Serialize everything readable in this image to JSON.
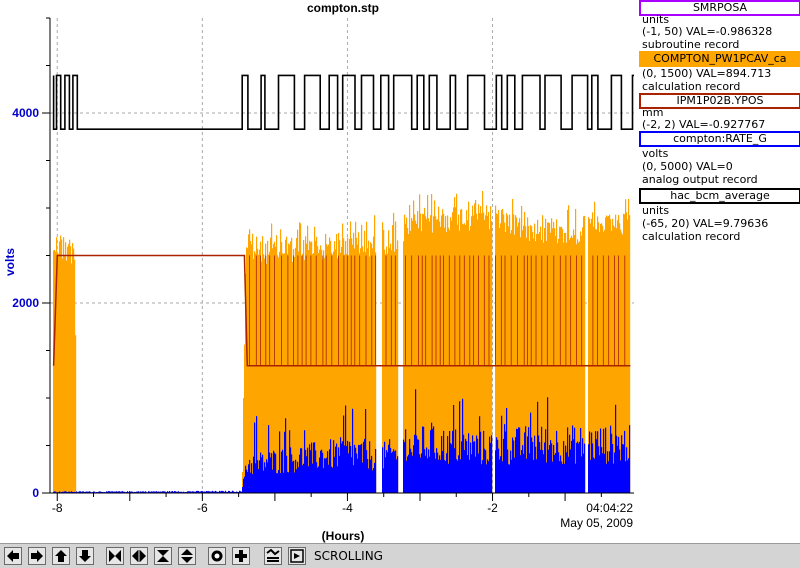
{
  "window": {
    "title": "compton.stp"
  },
  "chart_data": {
    "type": "line",
    "title": "compton.stp",
    "xlabel": "(Hours)",
    "ylabel": "volts",
    "xlim": [
      -8.1,
      -0.05
    ],
    "ylim": [
      0,
      5000
    ],
    "x_ticks": [
      -8,
      -6,
      -4,
      -2
    ],
    "x_tick_labels": [
      "-8",
      "-6",
      "-4",
      "-2"
    ],
    "y_ticks": [
      0,
      2000,
      4000
    ],
    "y_tick_labels": [
      "0",
      "2000",
      "4000"
    ],
    "grid": true,
    "end_time": "04:04:22",
    "end_date": "May 05, 2009",
    "series": [
      {
        "name": "SMRPOSA",
        "color": "#000000",
        "range": "(-1, 50)",
        "value_text": "VAL=-0.986328",
        "units": "units",
        "record_type": "subroutine record",
        "mean_high": 4395,
        "mean_low": 3830,
        "note_segments": [
          {
            "x_start": -8.05,
            "x_end": -7.75,
            "behavior": "high with dips"
          },
          {
            "x_start": -7.75,
            "x_end": -5.45,
            "behavior": "low"
          },
          {
            "x_start": -5.45,
            "x_end": -0.05,
            "behavior": "alternating high/low"
          }
        ]
      },
      {
        "name": "COMPTON_PW1PCAV_ca",
        "color": "#ffa500",
        "range": "(0, 1500)",
        "value_text": "VAL=894.713",
        "units": "",
        "record_type": "calculation record",
        "envelope_x": [
          -8.05,
          -7.75,
          -7.74,
          -5.45,
          -5.4,
          -4.0,
          -3.5,
          -3.3,
          -3.0,
          -2.5,
          -2.0,
          -1.5,
          -1.0,
          -0.1
        ],
        "envelope_y": [
          2750,
          2700,
          0,
          0,
          2700,
          2750,
          2800,
          2850,
          3000,
          3050,
          3050,
          2950,
          2900,
          2950
        ]
      },
      {
        "name": "IPM1P02B.YPOS",
        "color": "#aa2200",
        "range": "(-2, 2)",
        "value_text": "VAL=-0.927767",
        "units": "mm",
        "record_type": "",
        "level_high": 2500,
        "level_mid": 1340,
        "x": [
          -8.05,
          -8.0,
          -5.42,
          -5.38,
          -0.1
        ],
        "values": [
          1340,
          2500,
          2500,
          1340,
          1340
        ]
      },
      {
        "name": "compton:RATE_G",
        "color": "#0000ff",
        "range": "(0, 5000)",
        "value_text": "VAL=0",
        "units": "volts",
        "record_type": "analog output record",
        "envelope_x": [
          -8.05,
          -5.45,
          -5.4,
          -4.0,
          -3.5,
          -3.0,
          -2.0,
          -1.5,
          -0.1
        ],
        "envelope_y": [
          15,
          20,
          350,
          500,
          450,
          600,
          550,
          600,
          600
        ]
      },
      {
        "name": "hac_bcm_average",
        "color": "#000000",
        "range": "(-65, 20)",
        "value_text": "VAL=9.79636",
        "units": "units",
        "record_type": "calculation record"
      }
    ]
  },
  "toolbar": {
    "status": "SCROLLING",
    "buttons": [
      "arrow-left-icon",
      "arrow-right-icon",
      "arrow-up-icon",
      "arrow-down-icon",
      "zoom-in-x-icon",
      "zoom-out-x-icon",
      "zoom-in-y-icon",
      "zoom-out-y-icon",
      "record-icon",
      "plus-icon",
      "scale-icon",
      "fit-icon"
    ]
  },
  "colors": {
    "legend_border_1": "#aa00ff",
    "legend_border_2": "#ffa500",
    "legend_border_3": "#aa2200",
    "legend_border_4": "#0000ff",
    "legend_border_5": "#000000"
  }
}
